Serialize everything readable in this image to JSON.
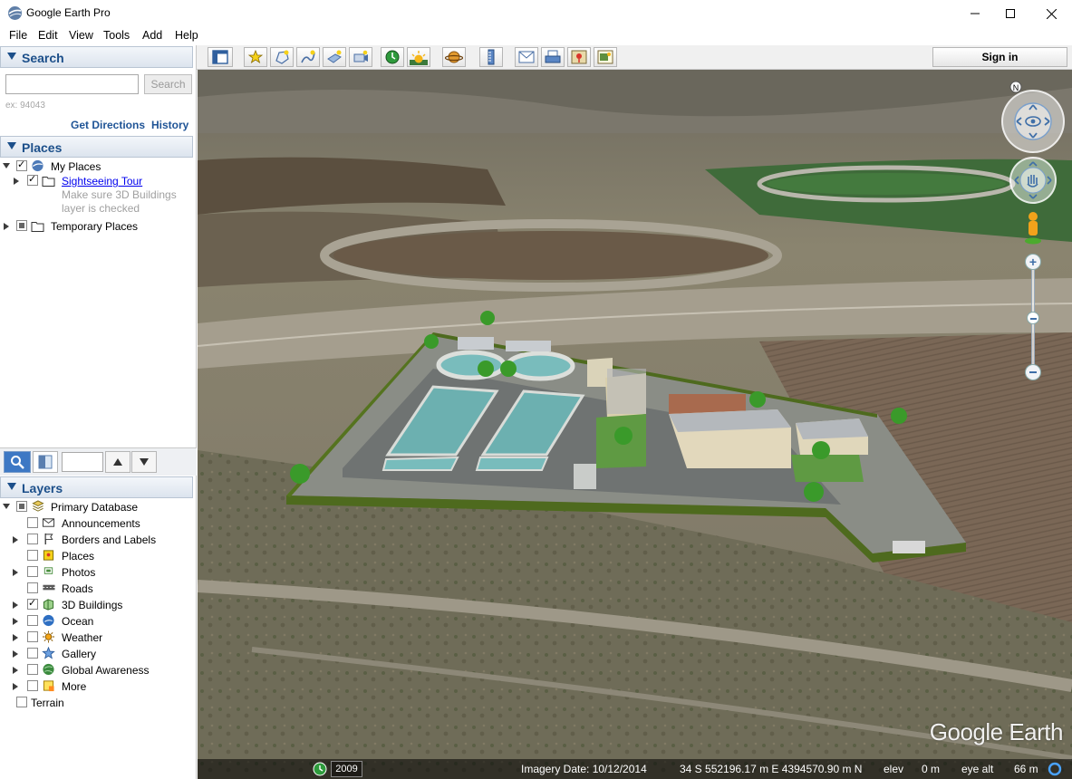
{
  "window": {
    "title": "Google Earth Pro"
  },
  "menu": {
    "items": [
      "File",
      "Edit",
      "View",
      "Tools",
      "Add",
      "Help"
    ]
  },
  "search": {
    "header": "Search",
    "placeholder": "",
    "button": "Search",
    "hint": "ex: 94043",
    "get_directions": "Get Directions",
    "history": "History"
  },
  "places": {
    "header": "Places",
    "items": [
      {
        "label": "My Places",
        "checked": true
      },
      {
        "label": "Sightseeing Tour",
        "checked": true,
        "link": true
      },
      {
        "label": "Make sure 3D Buildings"
      },
      {
        "label": "layer is checked"
      },
      {
        "label": "Temporary Places",
        "checked": "partial"
      }
    ]
  },
  "layers": {
    "header": "Layers",
    "items": [
      {
        "label": "Primary Database",
        "checked": "partial",
        "icon": "database-icon"
      },
      {
        "label": "Announcements",
        "checked": false,
        "icon": "envelope-icon"
      },
      {
        "label": "Borders and Labels",
        "checked": false,
        "icon": "flag-icon"
      },
      {
        "label": "Places",
        "checked": false,
        "icon": "places-icon"
      },
      {
        "label": "Photos",
        "checked": false,
        "icon": "photo-icon"
      },
      {
        "label": "Roads",
        "checked": false,
        "icon": "road-icon"
      },
      {
        "label": "3D Buildings",
        "checked": true,
        "icon": "building-icon"
      },
      {
        "label": "Ocean",
        "checked": false,
        "icon": "ocean-icon"
      },
      {
        "label": "Weather",
        "checked": false,
        "icon": "sun-icon"
      },
      {
        "label": "Gallery",
        "checked": false,
        "icon": "star-icon"
      },
      {
        "label": "Global Awareness",
        "checked": false,
        "icon": "globe-icon"
      },
      {
        "label": "More",
        "checked": false,
        "icon": "more-icon"
      },
      {
        "label": "Terrain",
        "checked": false
      }
    ]
  },
  "toolbar": {
    "sign_in": "Sign in"
  },
  "status": {
    "year": "2009",
    "imagery_date": "Imagery Date: 10/12/2014",
    "coordinates": "34 S 552196.17 m E 4394570.90 m N",
    "elev_label": "elev",
    "elev_value": "0 m",
    "eye_alt_label": "eye alt",
    "eye_alt_value": "66 m"
  },
  "map": {
    "watermark": "Google Earth"
  },
  "colors": {
    "header_blue": "#1c4f8a",
    "link_blue": "#0000ee",
    "wall_green": "#4e6a1e"
  }
}
